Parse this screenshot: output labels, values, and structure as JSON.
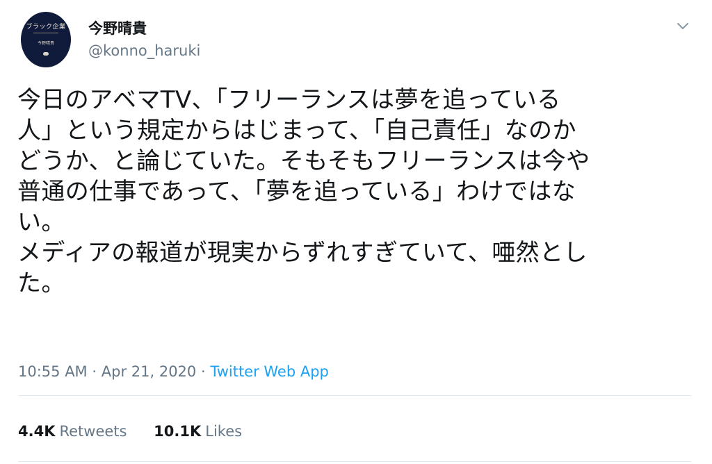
{
  "user": {
    "display_name": "今野晴貴",
    "handle": "@konno_haruki",
    "avatar": {
      "book_title": "ブラック企業",
      "book_author": "今野晴貴",
      "background_color": "#101a3a"
    }
  },
  "menu": {
    "icon": "chevron-down-icon"
  },
  "tweet": {
    "text": "今日のアベマTV、「フリーランスは夢を追っている\n人」という規定からはじまって、「自己責任」なのか\nどうか、と論じていた。そもそもフリーランスは今や\n普通の仕事であって、「夢を追っている」わけではな\nい。\nメディアの報道が現実からずれすぎていて、唖然とし\nた。",
    "time": "10:55 AM",
    "separator": "·",
    "date": "Apr 21, 2020",
    "source": "Twitter Web App"
  },
  "stats": {
    "retweets_count": "4.4K",
    "retweets_label": "Retweets",
    "likes_count": "10.1K",
    "likes_label": "Likes"
  },
  "colors": {
    "text": "#14171a",
    "secondary": "#657786",
    "link": "#1da1f2",
    "divider": "#e1e8ed"
  }
}
